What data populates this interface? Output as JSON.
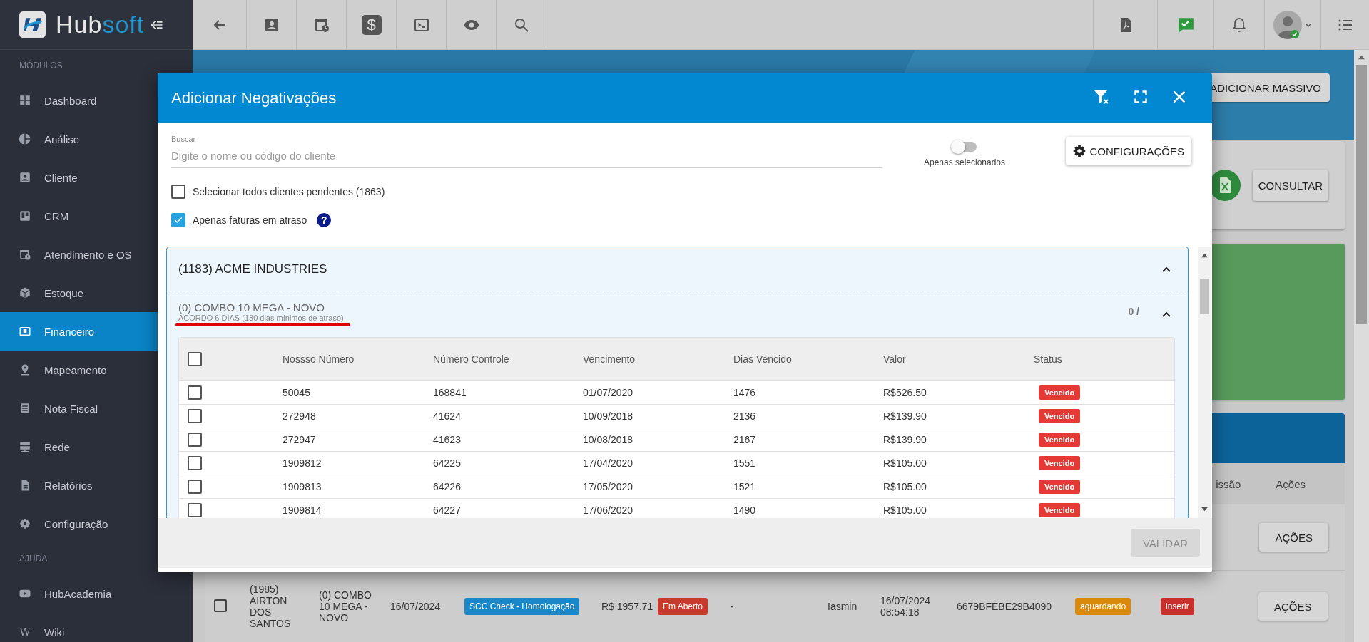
{
  "sidebar": {
    "logo_parts": [
      {
        "text": "Hub",
        "accent": false
      },
      {
        "text": "soft",
        "accent": true
      }
    ],
    "sections": [
      {
        "title": "MÓDULOS",
        "items": [
          {
            "label": "Dashboard",
            "selected": false
          },
          {
            "label": "Análise",
            "selected": false
          },
          {
            "label": "Cliente",
            "selected": false
          },
          {
            "label": "CRM",
            "selected": false
          },
          {
            "label": "Atendimento e OS",
            "selected": false
          },
          {
            "label": "Estoque",
            "selected": false
          },
          {
            "label": "Financeiro",
            "selected": true
          },
          {
            "label": "Mapeamento",
            "selected": false
          },
          {
            "label": "Nota Fiscal",
            "selected": false
          },
          {
            "label": "Rede",
            "selected": false
          },
          {
            "label": "Relatórios",
            "selected": false
          },
          {
            "label": "Configuração",
            "selected": false
          }
        ]
      },
      {
        "title": "AJUDA",
        "items": [
          {
            "label": "HubAcademia",
            "selected": false
          },
          {
            "label": "Wiki",
            "selected": false,
            "icon_text": "W"
          }
        ]
      }
    ]
  },
  "topbar": {
    "money_glyph": "$"
  },
  "background": {
    "mass_button": "ADICIONAR MASSIVO",
    "consult_button": "CONSULTAR",
    "table_headers": [
      "issão",
      "Ações"
    ],
    "rows": [
      {
        "action": "AÇÕES"
      },
      {
        "checked": false,
        "action": "AÇÕES",
        "cells": [
          {
            "kind": "text",
            "text": "(1985) AIRTON DOS SANTOS"
          },
          {
            "kind": "text",
            "text": "(0) COMBO 10 MEGA - NOVO"
          },
          {
            "kind": "text",
            "text": "16/07/2024"
          },
          {
            "kind": "badge",
            "text": "SCC Check - Homologação",
            "color": "#1a87c9"
          },
          {
            "kind": "text",
            "text": "R$ 1957.71"
          },
          {
            "kind": "badge",
            "text": "Em Aberto",
            "color": "#c93a2e"
          },
          {
            "kind": "text",
            "text": "-"
          },
          {
            "kind": "text",
            "text": "Iasmin"
          },
          {
            "kind": "text",
            "text": "16/07/2024 08:54:18"
          },
          {
            "kind": "text",
            "text": "6679BFEBE29B4090"
          },
          {
            "kind": "badge",
            "text": "aguardando",
            "color": "#d98a0b"
          },
          {
            "kind": "badge",
            "text": "inserir",
            "color": "#c9302c"
          }
        ]
      }
    ]
  },
  "modal": {
    "title": "Adicionar Negativações",
    "search": {
      "label": "Buscar",
      "placeholder": "Digite o nome ou código do cliente"
    },
    "toggle": {
      "label": "Apenas selecionados",
      "on": false
    },
    "config_button": "CONFIGURAÇÕES",
    "options": [
      {
        "label": "Selecionar todos clientes pendentes (1863)",
        "checked": false
      },
      {
        "label": "Apenas faturas em atraso",
        "checked": true,
        "help": "?"
      }
    ],
    "client": {
      "title": "(1183) ACME INDUSTRIES",
      "expanded": true,
      "plans": [
        {
          "title": "(0) COMBO 10 MEGA - NOVO",
          "subtitle": "ACORDO 6 DIAS (130 dias mínimos de atraso)",
          "count": "0 /",
          "expanded": true,
          "table": {
            "all_checked": false,
            "columns": [
              "Nossso Número",
              "Número Controle",
              "Vencimento",
              "Dias Vencido",
              "Valor",
              "Status"
            ],
            "rows": [
              {
                "checked": false,
                "cells": [
                  "50045",
                  "168841",
                  "01/07/2020",
                  "1476",
                  "R$526.50"
                ],
                "status": {
                  "text": "Vencido",
                  "color": "#e53935"
                }
              },
              {
                "checked": false,
                "cells": [
                  "272948",
                  "41624",
                  "10/09/2018",
                  "2136",
                  "R$139.90"
                ],
                "status": {
                  "text": "Vencido",
                  "color": "#e53935"
                }
              },
              {
                "checked": false,
                "cells": [
                  "272947",
                  "41623",
                  "10/08/2018",
                  "2167",
                  "R$139.90"
                ],
                "status": {
                  "text": "Vencido",
                  "color": "#e53935"
                }
              },
              {
                "checked": false,
                "cells": [
                  "1909812",
                  "64225",
                  "17/04/2020",
                  "1551",
                  "R$105.00"
                ],
                "status": {
                  "text": "Vencido",
                  "color": "#e53935"
                }
              },
              {
                "checked": false,
                "cells": [
                  "1909813",
                  "64226",
                  "17/05/2020",
                  "1521",
                  "R$105.00"
                ],
                "status": {
                  "text": "Vencido",
                  "color": "#e53935"
                }
              },
              {
                "checked": false,
                "cells": [
                  "1909814",
                  "64227",
                  "17/06/2020",
                  "1490",
                  "R$105.00"
                ],
                "status": {
                  "text": "Vencido",
                  "color": "#e53935"
                }
              }
            ]
          }
        }
      ]
    },
    "validate_button": {
      "label": "VALIDAR",
      "disabled": true
    }
  }
}
